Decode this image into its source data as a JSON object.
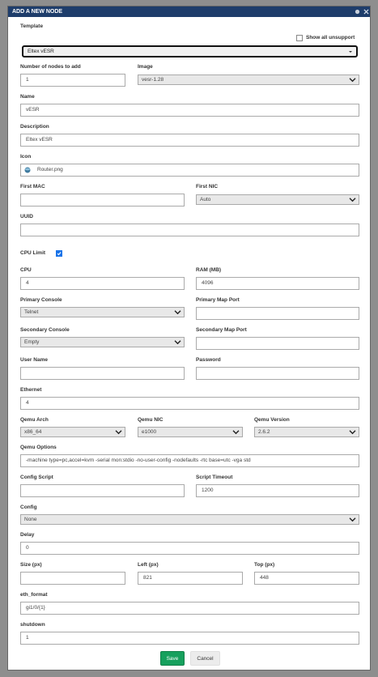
{
  "dialog": {
    "title": "ADD A NEW NODE"
  },
  "template": {
    "label": "Template",
    "show_all_label": "Show all unsupport",
    "selected": "Eltex vESR"
  },
  "nodes": {
    "label": "Number of nodes to add",
    "value": "1"
  },
  "image": {
    "label": "Image",
    "selected": "vesr-1.28"
  },
  "name": {
    "label": "Name",
    "value": "vESR"
  },
  "description": {
    "label": "Description",
    "value": "Eltex vESR"
  },
  "icon": {
    "label": "Icon",
    "value": "Router.png"
  },
  "first_mac": {
    "label": "First MAC",
    "value": ""
  },
  "first_nic": {
    "label": "First NIC",
    "selected": "Auto"
  },
  "uuid": {
    "label": "UUID",
    "value": ""
  },
  "cpu_limit": {
    "label": "CPU Limit",
    "checked": true
  },
  "cpu": {
    "label": "CPU",
    "value": "4"
  },
  "ram": {
    "label": "RAM (MB)",
    "value": "4096"
  },
  "primary_console": {
    "label": "Primary Console",
    "selected": "Telnet"
  },
  "primary_map_port": {
    "label": "Primary Map Port",
    "value": ""
  },
  "secondary_console": {
    "label": "Secondary Console",
    "selected": "Empty"
  },
  "secondary_map_port": {
    "label": "Secondary Map Port",
    "value": ""
  },
  "username": {
    "label": "User Name",
    "value": ""
  },
  "password": {
    "label": "Password",
    "value": ""
  },
  "ethernet": {
    "label": "Ethernet",
    "value": "4"
  },
  "qemu_arch": {
    "label": "Qemu Arch",
    "selected": "x86_64"
  },
  "qemu_nic": {
    "label": "Qemu NIC",
    "selected": "e1000"
  },
  "qemu_version": {
    "label": "Qemu Version",
    "selected": "2.6.2"
  },
  "qemu_options": {
    "label": "Qemu Options",
    "value": "-machine type=pc,accel=kvm -serial mon:stdio -no-user-config -nodefaults -rtc base=utc -vga std"
  },
  "config_script": {
    "label": "Config Script",
    "value": ""
  },
  "script_timeout": {
    "label": "Script Timeout",
    "value": "1200"
  },
  "config": {
    "label": "Config",
    "selected": "None"
  },
  "delay": {
    "label": "Delay",
    "value": "0"
  },
  "size": {
    "label": "Size (px)",
    "value": ""
  },
  "left": {
    "label": "Left (px)",
    "value": "821"
  },
  "top": {
    "label": "Top (px)",
    "value": "448"
  },
  "eth_format": {
    "label": "eth_format",
    "value": "gi1/0/{1}"
  },
  "shutdown": {
    "label": "shutdown",
    "value": "1"
  },
  "buttons": {
    "save": "Save",
    "cancel": "Cancel"
  },
  "colors": {
    "titlebar": "#1e3d6b",
    "save": "#16a05d",
    "checkbox": "#1a73e8"
  },
  "icons": [
    "circle-icon",
    "close-icon",
    "caret-down-icon",
    "chevron-down-icon",
    "router-icon",
    "checkmark-icon"
  ]
}
